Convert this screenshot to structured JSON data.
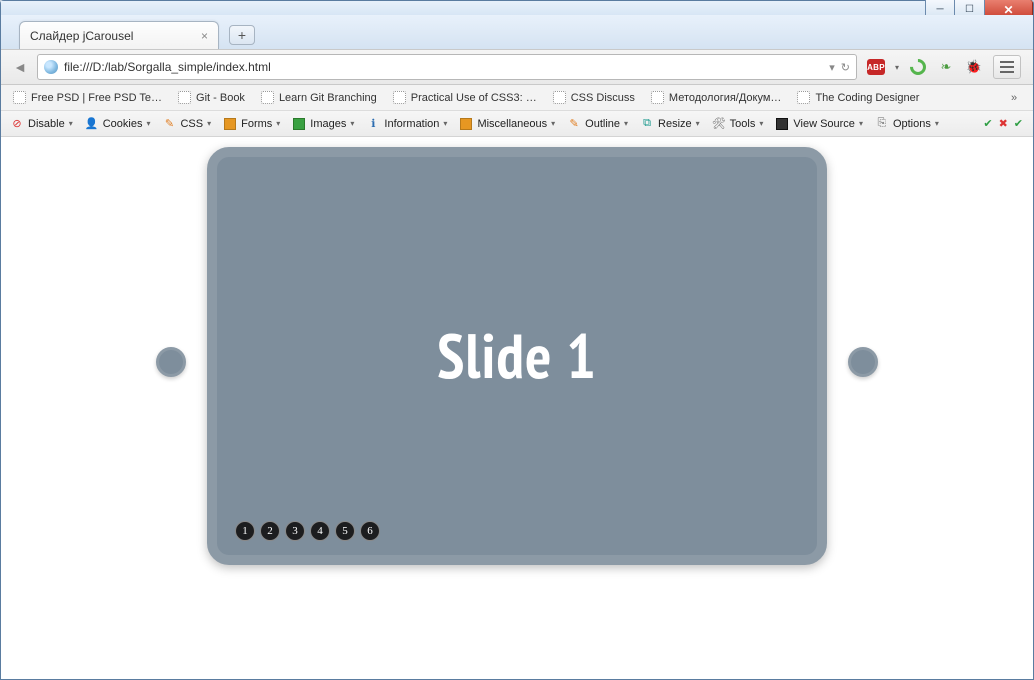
{
  "window": {
    "controls": {
      "min": "─",
      "max": "☐",
      "close": "✕"
    }
  },
  "tab": {
    "title": "Слайдер jCarousel",
    "new": "+"
  },
  "nav": {
    "back": "◄",
    "url": "file:///D:/lab/Sorgalla_simple/index.html",
    "reload": "↻",
    "dropdown": "▾",
    "abp": "ABP"
  },
  "bookmarks": [
    "Free PSD | Free PSD Te…",
    "Git - Book",
    "Learn Git Branching",
    "Practical Use of CSS3: …",
    "CSS Discuss",
    "Методология/Докум…",
    "The Coding Designer"
  ],
  "bookmore": "»",
  "devbar": {
    "items": [
      {
        "label": "Disable",
        "icon": "⊘",
        "cls": "c-red"
      },
      {
        "label": "Cookies",
        "icon": "👤",
        "cls": "c-gray"
      },
      {
        "label": "CSS",
        "icon": "✎",
        "cls": "c-orange"
      },
      {
        "label": "Forms",
        "icon": "📋",
        "cls": "c-orange"
      },
      {
        "label": "Images",
        "icon": "🖼",
        "cls": "c-green"
      },
      {
        "label": "Information",
        "icon": "ℹ",
        "cls": "c-blue"
      },
      {
        "label": "Miscellaneous",
        "icon": "■",
        "cls": "c-orange"
      },
      {
        "label": "Outline",
        "icon": "✎",
        "cls": "c-orange"
      },
      {
        "label": "Resize",
        "icon": "⧉",
        "cls": "c-teal"
      },
      {
        "label": "Tools",
        "icon": "✕",
        "cls": "c-gray"
      },
      {
        "label": "View Source",
        "icon": "■",
        "cls": "c-darkgreen"
      },
      {
        "label": "Options",
        "icon": "⎍",
        "cls": "c-gray"
      }
    ],
    "checks": [
      "✔",
      "✖",
      "✔"
    ]
  },
  "carousel": {
    "slide_text": "Slide 1",
    "pages": [
      "1",
      "2",
      "3",
      "4",
      "5",
      "6"
    ]
  }
}
